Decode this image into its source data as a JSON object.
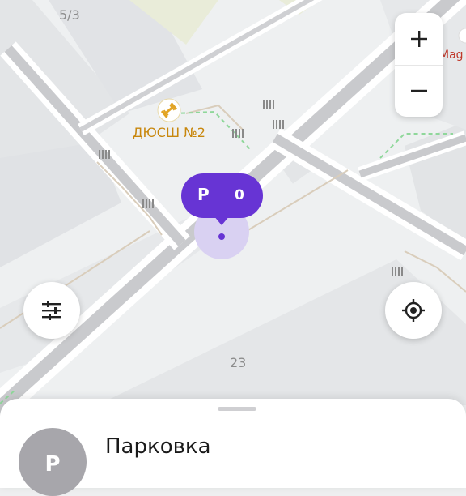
{
  "map": {
    "labels": {
      "house_top": "5/3",
      "sport_school": "ДЮСШ №2",
      "store": "Mag",
      "house_bottom": "23"
    },
    "sport_school_color": "#c8870d",
    "store_color": "#c0392b"
  },
  "zoom": {
    "in_label": "+",
    "out_label": "−"
  },
  "parking_pin": {
    "letter": "P",
    "count": "0",
    "color": "#6734d4"
  },
  "controls": {
    "filter_icon": "sliders-icon",
    "locate_icon": "crosshair-icon"
  },
  "sheet": {
    "avatar_letter": "P",
    "title": "Парковка",
    "avatar_color": "#a7a6ab"
  }
}
